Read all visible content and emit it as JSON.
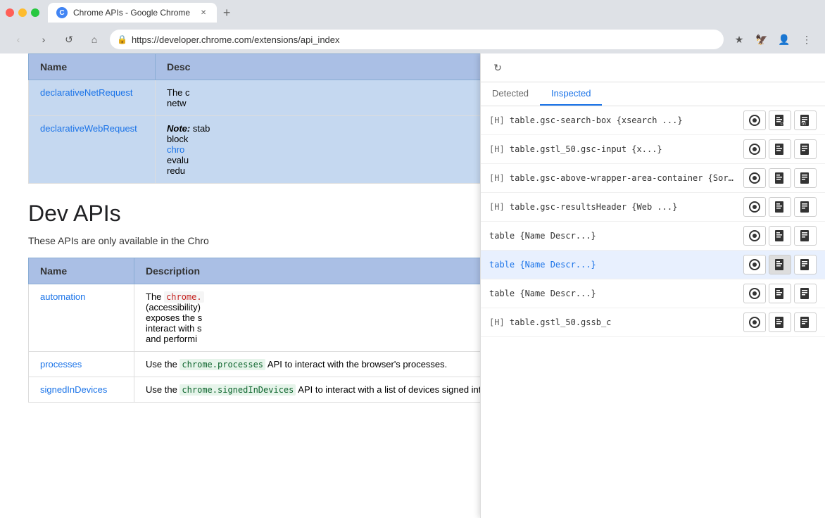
{
  "browser": {
    "tab_title": "Chrome APIs - Google Chrome",
    "tab_favicon": "C",
    "url": "https://developer.chrome.com/extensions/api_index",
    "new_tab_label": "+"
  },
  "nav": {
    "back_label": "‹",
    "forward_label": "›",
    "reload_label": "↺",
    "home_label": "⌂",
    "bookmark_label": "★",
    "menu_label": "⋮"
  },
  "page": {
    "table1": {
      "headers": [
        "Name",
        "Description"
      ],
      "rows": [
        {
          "name": "declarativeNetRequest",
          "desc_prefix": "The c",
          "desc_suffix": "netw",
          "is_blue": true
        },
        {
          "name": "declarativeWebRequest",
          "note": "Note:",
          "desc_note": "stab",
          "desc_lines": [
            "block",
            "chro",
            "evalu",
            "redu"
          ],
          "is_blue": true
        }
      ]
    },
    "dev_apis": {
      "title": "Dev APIs",
      "description": "These APIs are only available in the Chro"
    },
    "table2": {
      "headers": [
        "Name",
        "Description"
      ],
      "rows": [
        {
          "name": "automation",
          "desc": "The chrome. (accessibility) exposes the s interact with s and performi"
        },
        {
          "name": "processes",
          "desc": "Use the chrome.processes API to interact with the browser's processes.",
          "code": "chrome.processes"
        },
        {
          "name": "signedInDevices",
          "desc_prefix": "Use the ",
          "code": "chrome.signedInDevices",
          "desc_suffix": " API to interact with a list of devices signed into chrome with the same account as the current profile."
        }
      ]
    }
  },
  "panel": {
    "refresh_icon": "↻",
    "tabs": [
      {
        "label": "Detected",
        "active": false
      },
      {
        "label": "Inspected",
        "active": true
      }
    ],
    "items": [
      {
        "tag": "[H]",
        "label": "table.gsc-search-box {xsearch ...}",
        "highlighted": false
      },
      {
        "tag": "[H]",
        "label": "table.gstl_50.gsc-input {x...}",
        "highlighted": false
      },
      {
        "tag": "[H]",
        "label": "table.gsc-above-wrapper-area-container {Sort ...",
        "highlighted": false
      },
      {
        "tag": "[H]",
        "label": "table.gsc-resultsHeader {Web    ...}",
        "highlighted": false
      },
      {
        "tag": "",
        "label": "table {Name Descr...}",
        "highlighted": false
      },
      {
        "tag": "",
        "label": "table {Name Descr...}",
        "highlighted": true
      },
      {
        "tag": "",
        "label": "table {Name Descr...}",
        "highlighted": false
      },
      {
        "tag": "[H]",
        "label": "table.gstl_50.gssb_c",
        "highlighted": false
      }
    ],
    "action_icons": {
      "circle": "⊙",
      "cv": "CV",
      "txt": "TXT"
    }
  }
}
